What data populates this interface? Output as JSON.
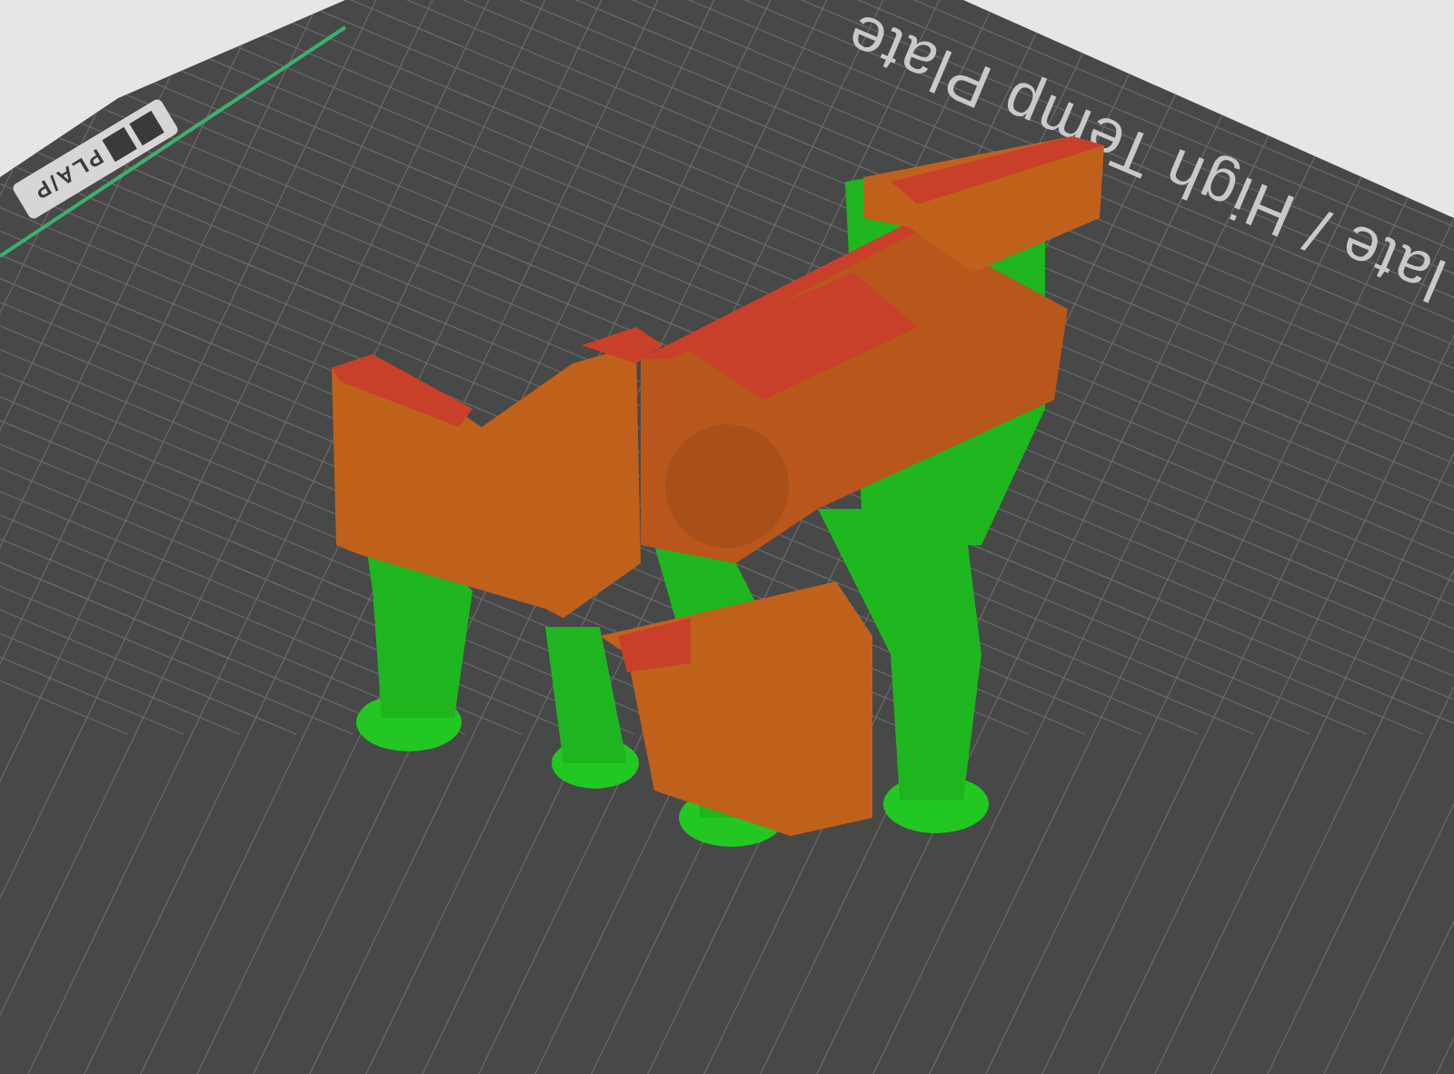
{
  "viewport": {
    "plate_name": "late / High Temp Plate",
    "plate_label": "PLA/P"
  }
}
